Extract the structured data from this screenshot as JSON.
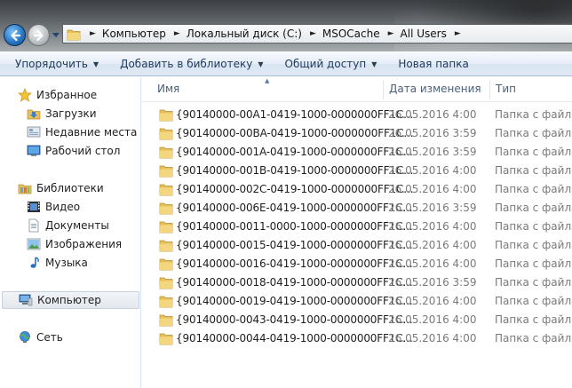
{
  "address": {
    "crumbs": [
      "Компьютер",
      "Локальный диск (C:)",
      "MSOCache",
      "All Users"
    ]
  },
  "toolbar": {
    "organize": "Упорядочить",
    "add_to_library": "Добавить в библиотеку",
    "share": "Общий доступ",
    "new_folder": "Новая папка"
  },
  "sidebar": {
    "favorites": "Избранное",
    "downloads": "Загрузки",
    "recent": "Недавние места",
    "desktop": "Рабочий стол",
    "libraries": "Библиотеки",
    "video": "Видео",
    "documents": "Документы",
    "images": "Изображения",
    "music": "Музыка",
    "computer": "Компьютер",
    "network": "Сеть"
  },
  "columns": {
    "name": "Имя",
    "date": "Дата изменения",
    "type": "Тип"
  },
  "files": [
    {
      "name": "{90140000-00A1-0419-1000-0000000FF1C...",
      "date": "26.05.2016 4:00",
      "type": "Папка с файлами"
    },
    {
      "name": "{90140000-00BA-0419-1000-0000000FF1C...",
      "date": "26.05.2016 3:59",
      "type": "Папка с файлами"
    },
    {
      "name": "{90140000-001A-0419-1000-0000000FF1C...",
      "date": "26.05.2016 3:59",
      "type": "Папка с файлами"
    },
    {
      "name": "{90140000-001B-0419-1000-0000000FF1C...",
      "date": "26.05.2016 4:00",
      "type": "Папка с файлами"
    },
    {
      "name": "{90140000-002C-0419-1000-0000000FF1C...",
      "date": "26.05.2016 4:00",
      "type": "Папка с файлами"
    },
    {
      "name": "{90140000-006E-0419-1000-0000000FF1C...",
      "date": "26.05.2016 3:59",
      "type": "Папка с файлами"
    },
    {
      "name": "{90140000-0011-0000-1000-0000000FF1C...",
      "date": "26.05.2016 4:00",
      "type": "Папка с файлами"
    },
    {
      "name": "{90140000-0015-0419-1000-0000000FF1C...",
      "date": "26.05.2016 4:00",
      "type": "Папка с файлами"
    },
    {
      "name": "{90140000-0016-0419-1000-0000000FF1C...",
      "date": "26.05.2016 4:00",
      "type": "Папка с файлами"
    },
    {
      "name": "{90140000-0018-0419-1000-0000000FF1C...",
      "date": "26.05.2016 3:59",
      "type": "Папка с файлами"
    },
    {
      "name": "{90140000-0019-0419-1000-0000000FF1C...",
      "date": "26.05.2016 4:00",
      "type": "Папка с файлами"
    },
    {
      "name": "{90140000-0043-0419-1000-0000000FF1C...",
      "date": "26.05.2016 4:00",
      "type": "Папка с файлами"
    },
    {
      "name": "{90140000-0044-0419-1000-0000000FF1C...",
      "date": "26.05.2016 4:00",
      "type": "Папка с файлами"
    }
  ],
  "icons": {
    "folder_color": "#e8c15a",
    "accent": "#1e395b"
  }
}
